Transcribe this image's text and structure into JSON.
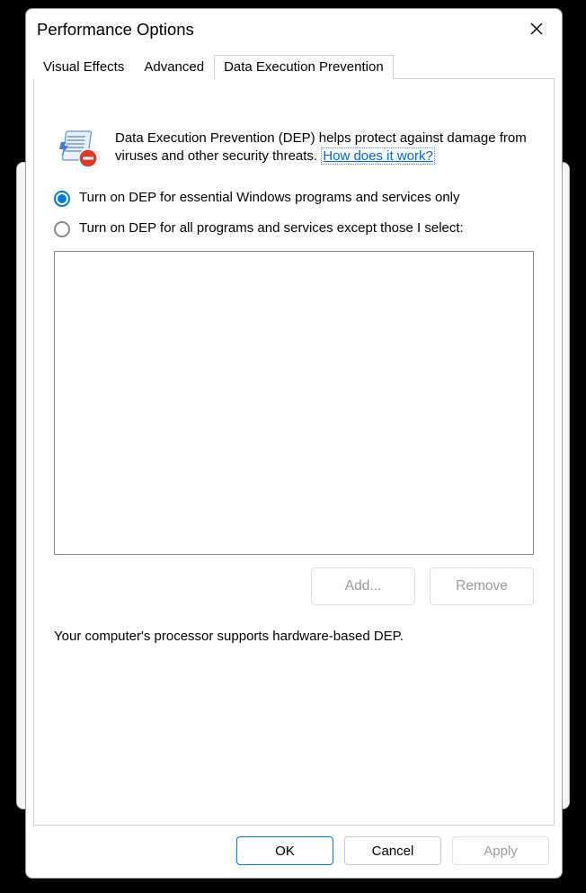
{
  "window": {
    "title": "Performance Options"
  },
  "tabs": {
    "items": [
      {
        "label": "Visual Effects"
      },
      {
        "label": "Advanced"
      },
      {
        "label": "Data Execution Prevention"
      }
    ],
    "active_index": 2
  },
  "dep_panel": {
    "intro_text": "Data Execution Prevention (DEP) helps protect against damage from viruses and other security threats. ",
    "link_text": "How does it work?",
    "radio_options": [
      {
        "label": "Turn on DEP for essential Windows programs and services only",
        "checked": true
      },
      {
        "label": "Turn on DEP for all programs and services except those I select:",
        "checked": false
      }
    ],
    "add_button": "Add...",
    "remove_button": "Remove",
    "status_text": "Your computer's processor supports hardware-based DEP."
  },
  "dialog_buttons": {
    "ok": "OK",
    "cancel": "Cancel",
    "apply": "Apply"
  }
}
